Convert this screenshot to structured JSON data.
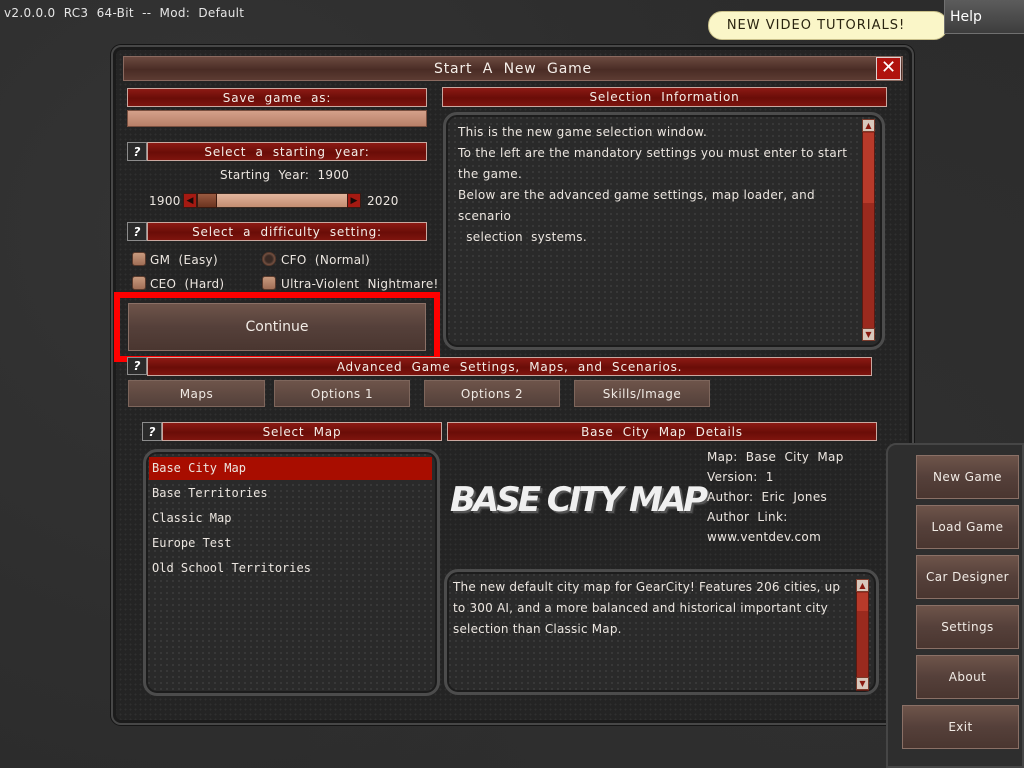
{
  "top_bar": {
    "version": "v2.0.0.0  RC3  64-Bit  --  Mod:  Default",
    "tutorial_label": "NEW  VIDEO  TUTORIALS!",
    "help_label": "Help"
  },
  "window": {
    "title": "Start  A  New  Game",
    "close_glyph": "✕"
  },
  "save": {
    "header": "Save  game  as:",
    "value": ""
  },
  "year": {
    "help_glyph": "?",
    "header": "Select  a  starting  year:",
    "starting_label": "Starting  Year:  1900",
    "min": "1900",
    "max": "2020",
    "value": 1900
  },
  "difficulty": {
    "help_glyph": "?",
    "header": "Select  a  difficulty  setting:",
    "options": [
      "GM  (Easy)",
      "CFO  (Normal)",
      "CEO  (Hard)",
      "Ultra-Violent  Nightmare!"
    ],
    "selected": "CFO  (Normal)"
  },
  "continue_label": "Continue",
  "selection_info": {
    "header": "Selection  Information",
    "lines": [
      "This  is  the  new  game  selection  window.",
      "To  the  left  are  the  mandatory  settings  you  must  enter  to  start",
      "the  game.",
      "Below  are  the  advanced  game  settings,  map  loader,  and  scenario",
      "  selection  systems."
    ]
  },
  "advanced": {
    "help_glyph": "?",
    "header": "Advanced  Game  Settings,  Maps,  and  Scenarios.",
    "tabs": [
      "Maps",
      "Options  1",
      "Options  2",
      "Skills/Image"
    ]
  },
  "map_select": {
    "help_glyph": "?",
    "header": "Select  Map",
    "items": [
      "Base City Map",
      "Base Territories",
      "Classic Map",
      "Europe Test",
      "Old School Territories"
    ],
    "selected": "Base City Map"
  },
  "map_details": {
    "header": "Base  City  Map  Details",
    "logo_text": "BASE CITY MAP",
    "lines": [
      "Map:  Base  City  Map",
      "Version:  1",
      "Author:  Eric  Jones",
      "Author  Link:",
      "www.ventdev.com"
    ],
    "description": "The  new  default  city  map  for  GearCity!  Features  206  cities,  up  to  300  AI,  and  a  more  balanced  and  historical  important  city  selection  than  Classic  Map."
  },
  "side_menu": {
    "items": [
      "New  Game",
      "Load  Game",
      "Car  Designer",
      "Settings",
      "About",
      "Exit"
    ]
  },
  "icons": {
    "scroll_up": "▲",
    "scroll_down": "▼",
    "slider_left": "◀",
    "slider_right": "▶"
  },
  "colors": {
    "accent_red": "#a80d00",
    "button_brown": "#55403a",
    "highlight": "#ff0000"
  }
}
